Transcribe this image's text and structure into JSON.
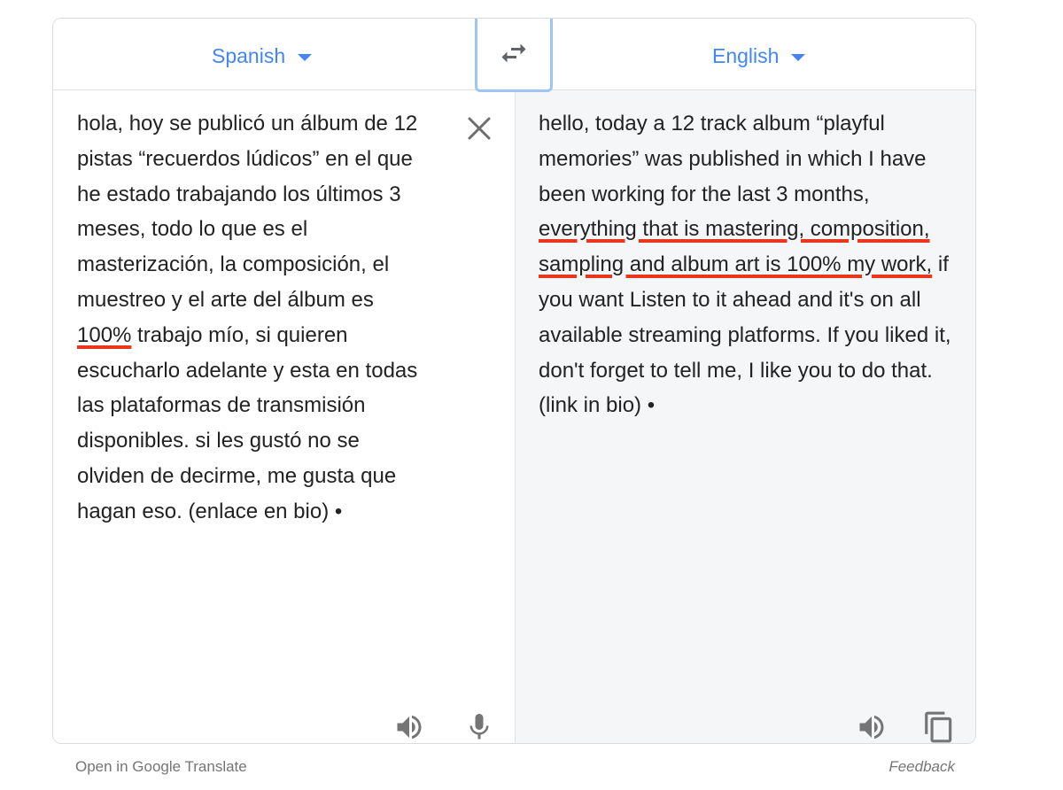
{
  "header": {
    "source_language": "Spanish",
    "target_language": "English"
  },
  "source": {
    "segments": [
      "hola, hoy se publicó un álbum de 12 pistas “recuerdos lúdicos” en el que he estado trabajando los últimos 3 meses, todo lo que es el masterización, la composición, el muestreo y el arte del álbum es ",
      "100%",
      " trabajo mío, si quieren escucharlo adelante y esta en todas las plataformas de transmisión disponibles. si les gustó no se olviden de decirme, me gusta que hagan eso. (enlace en bio) •"
    ]
  },
  "target": {
    "segments": [
      "hello, today a 12 track album “playful memories” was published in which I have been working for the last 3 months, ",
      "everything that is mastering, composition, sampling and album art is 100% my work,",
      " if you want Listen to it ahead and it's on all available streaming platforms. If you liked it, don't forget to tell me, I like you to do that. (link in bio) •"
    ]
  },
  "footer": {
    "open_link": "Open in Google Translate",
    "feedback_link": "Feedback"
  },
  "colors": {
    "accent": "#4285f4",
    "swap_focus": "#9fc5f8",
    "annotation_red": "#e8371c",
    "icon_gray": "#757575"
  },
  "icons": {
    "swap": "swap-icon",
    "clear": "close-icon",
    "speaker": "speaker-icon",
    "mic": "microphone-icon",
    "copy": "copy-icon"
  }
}
